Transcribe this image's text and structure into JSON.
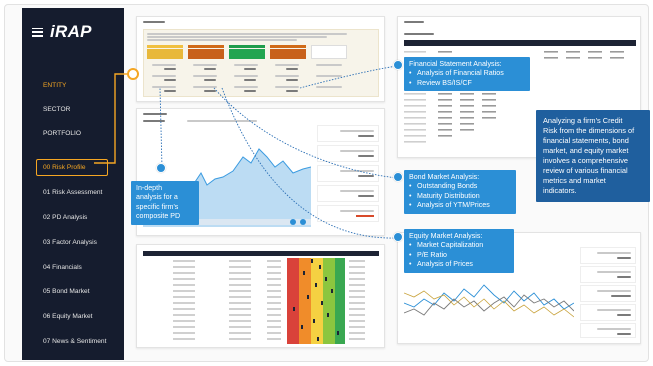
{
  "app": {
    "logo": "iRAP"
  },
  "sidebar": {
    "items": [
      {
        "label": "ENTITY"
      },
      {
        "label": "SECTOR"
      },
      {
        "label": "PORTFOLIO"
      },
      {
        "label": "00 Risk Profile"
      },
      {
        "label": "01 Risk Assessment"
      },
      {
        "label": "02 PD Analysis"
      },
      {
        "label": "03 Factor Analysis"
      },
      {
        "label": "04 Financials"
      },
      {
        "label": "05 Bond Market"
      },
      {
        "label": "06 Equity Market"
      },
      {
        "label": "07 News & Sentiment"
      }
    ]
  },
  "callouts": {
    "financial": {
      "title": "Financial Statement Analysis:",
      "items": [
        "Analysis of Financial Ratios",
        "Review BS/IS/CF"
      ]
    },
    "bond": {
      "title": "Bond Market Analysis:",
      "items": [
        "Outstanding Bonds",
        "Maturity Distribution",
        "Analysis of YTM/Prices"
      ]
    },
    "equity": {
      "title": "Equity Market Analysis:",
      "items": [
        "Market Capitalization",
        "P/E Ratio",
        "Analysis of Prices"
      ]
    },
    "pd": {
      "lines": [
        "In-depth",
        "analysis for a",
        "specific firm's",
        "composite PD"
      ]
    },
    "summary": {
      "lines": [
        "Analyzing a firm's Credit",
        "Risk from the dimensions of",
        "financial statements, bond",
        "market, and equity market",
        "involves a comprehensive",
        "review of various financial",
        "metrics and market",
        "indicators."
      ]
    }
  },
  "colors": {
    "accent": "#f5a623",
    "callout": "#2b8fd6",
    "summary": "#1f5f9e",
    "sidebar": "#151c2e",
    "chart_line": "#3b9be0"
  }
}
